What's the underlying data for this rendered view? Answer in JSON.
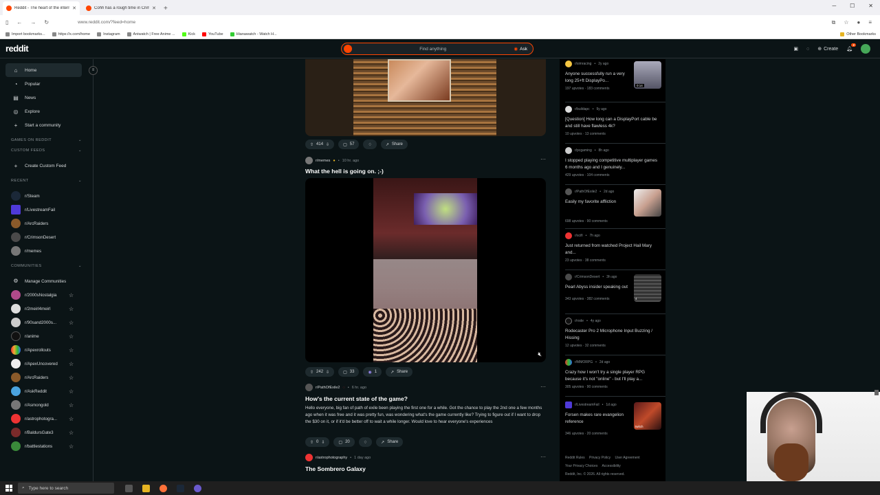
{
  "browser": {
    "tabs": [
      {
        "title": "Reddit - The heart of the intern",
        "active": true
      },
      {
        "title": "Cohh has a rough time in Crims",
        "active": false
      }
    ],
    "url": "www.reddit.com/?feed=home",
    "bookmarks": [
      "Import bookmarks...",
      "https://x.com/home",
      "Instagram",
      "Aniwatch | Free Anime ...",
      "Kick",
      "YouTube",
      "Hianawatch - Watch H..."
    ],
    "other_bookmarks": "Other Bookmarks"
  },
  "header": {
    "logo": "reddit",
    "search_placeholder": "Find anything",
    "ask_label": "Ask",
    "create_label": "Create",
    "notification_count": "2"
  },
  "sidebar": {
    "nav": [
      {
        "label": "Home",
        "icon": "home-icon",
        "active": true
      },
      {
        "label": "Popular",
        "icon": "popular-icon"
      },
      {
        "label": "News",
        "icon": "news-icon"
      },
      {
        "label": "Explore",
        "icon": "explore-icon"
      },
      {
        "label": "Start a community",
        "icon": "plus-icon"
      }
    ],
    "games_heading": "GAMES ON REDDIT",
    "custom_feeds_heading": "CUSTOM FEEDS",
    "create_custom_feed": "Create Custom Feed",
    "recent_heading": "RECENT",
    "recent": [
      "r/Steam",
      "r/LivestreamFail",
      "r/ArcRaiders",
      "r/CrimsonDesert",
      "r/memes"
    ],
    "communities_heading": "COMMUNITIES",
    "manage_communities": "Manage Communities",
    "communities": [
      "r/2000sNostalgia",
      "r/2meirl4meirl",
      "r/90sand2000s...",
      "r/anime",
      "r/Apexrollouts",
      "r/ApexUncovered",
      "r/ArcRaiders",
      "r/AskReddit",
      "r/Asmongold",
      "r/astrophotogra...",
      "r/BaldursGate3",
      "r/battlestations"
    ]
  },
  "feed": {
    "post0": {
      "upvotes": "414",
      "comments": "57",
      "share": "Share"
    },
    "post1": {
      "subreddit": "r/memes",
      "time": "10 hr. ago",
      "title": "What the hell is going on. ;-)",
      "upvotes": "242",
      "comments": "33",
      "awards": "1",
      "share": "Share"
    },
    "post2": {
      "subreddit": "r/PathOfExile2",
      "time": "6 hr. ago",
      "title": "How's the current state of the game?",
      "body": "Hello everyone, big fan of path of exile been playing the first one for a while. Got the chance to play the 2nd one a few months ago when it was free and it was pretty fun, was wondering what's the game currently like? Trying to figure out if I want to drop the $30 on it, or if it'd be better off to wait a while longer. Would love to hear everyone's experiences",
      "upvotes": "0",
      "comments": "20",
      "share": "Share"
    },
    "post3": {
      "subreddit": "r/astrophotography",
      "time": "1 day ago",
      "title": "The Sombrero Galaxy"
    }
  },
  "recent_posts": [
    {
      "sub": "r/simracing",
      "time": "2y ago",
      "title": "Anyone successfully run a very long 25+ft DisplayPo...",
      "stats": "197 upvotes  ·  183 comments",
      "thumb_label": "0:14"
    },
    {
      "sub": "r/buildapc",
      "time": "9y ago",
      "title": "[Question] How long can a DisplayPort cable be and still have flawless 4k?",
      "stats": "10 upvotes  ·  13 comments"
    },
    {
      "sub": "r/pcgaming",
      "time": "8h ago",
      "title": "I stopped playing competitive multiplayer games 6 months ago and I genuinely...",
      "stats": "429 upvotes  ·  104 comments"
    },
    {
      "sub": "r/PathOfExile2",
      "time": "2d ago",
      "title": "Easily my favorite affliction",
      "stats": "698 upvotes  ·  90 comments"
    },
    {
      "sub": "r/scifi",
      "time": "7h ago",
      "title": "Just returned from watched Project Hail Mary and...",
      "stats": "23 upvotes  ·  38 comments"
    },
    {
      "sub": "r/CrimsonDesert",
      "time": "3h ago",
      "title": "Pearl Abyss insider speaking out",
      "stats": "343 upvotes  ·  382 comments",
      "thumb_label": "4"
    },
    {
      "sub": "r/rode",
      "time": "4y ago",
      "title": "Rodecaster Pro 2 Microphone Input Buzzing / Hissing",
      "stats": "12 upvotes  ·  32 comments"
    },
    {
      "sub": "r/MMORPG",
      "time": "2d ago",
      "title": "Crazy how I won't try a single player RPG because it's not \"online\" - but I'll play a...",
      "stats": "305 upvotes  ·  90 comments"
    },
    {
      "sub": "r/LivestreamFail",
      "time": "1d ago",
      "title": "Forsen makes rare evangelion reference",
      "stats": "346 upvotes  ·  20 comments",
      "thumb_label": "twitch"
    }
  ],
  "footer": {
    "links": [
      "Reddit Rules",
      "Privacy Policy",
      "User Agreement",
      "Your Privacy Choices",
      "Accessibility"
    ],
    "copyright": "Reddit, Inc. © 2026. All rights reserved."
  },
  "taskbar": {
    "search_placeholder": "Type here to search"
  }
}
